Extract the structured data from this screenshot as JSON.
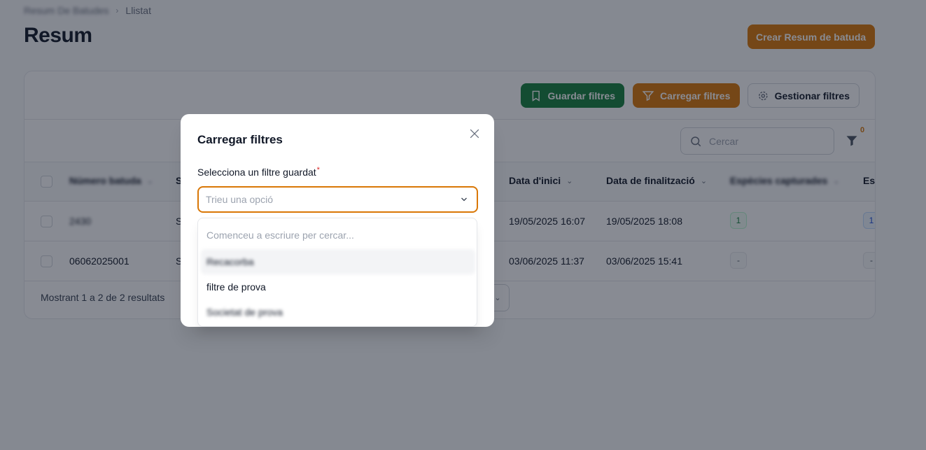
{
  "breadcrumb": {
    "parent": "Resum De Batudes",
    "current": "Llistat"
  },
  "page": {
    "title": "Resum",
    "create_button": "Crear Resum de batuda"
  },
  "toolbar": {
    "save_filters": "Guardar filtres",
    "load_filters": "Carregar filtres",
    "manage_filters": "Gestionar filtres"
  },
  "search": {
    "placeholder": "Cercar"
  },
  "filter_count": "0",
  "table": {
    "columns": [
      "Número batuda",
      "S",
      "Data d'inici",
      "Data de finalització",
      "Espècies capturades",
      "Es"
    ],
    "rows": [
      {
        "numero": "2430",
        "s": "S",
        "inici": "19/05/2025 16:07",
        "final": "19/05/2025 18:08",
        "especies": "1",
        "es": "1"
      },
      {
        "numero": "06062025001",
        "s": "S",
        "inici": "03/06/2025 11:37",
        "final": "03/06/2025 15:41",
        "especies": "-",
        "es": "-"
      }
    ]
  },
  "footer": {
    "results_text": "Mostrant 1 a 2 de 2 resultats"
  },
  "modal": {
    "title": "Carregar filtres",
    "field_label": "Selecciona un filtre guardat",
    "required_mark": "*",
    "select_placeholder": "Trieu una opció",
    "search_placeholder": "Comenceu a escriure per cercar...",
    "options": [
      "Recacorba",
      "filtre de prova",
      "Societat de prova"
    ]
  },
  "colors": {
    "primary_orange": "#d97706",
    "success_green": "#15803d"
  }
}
